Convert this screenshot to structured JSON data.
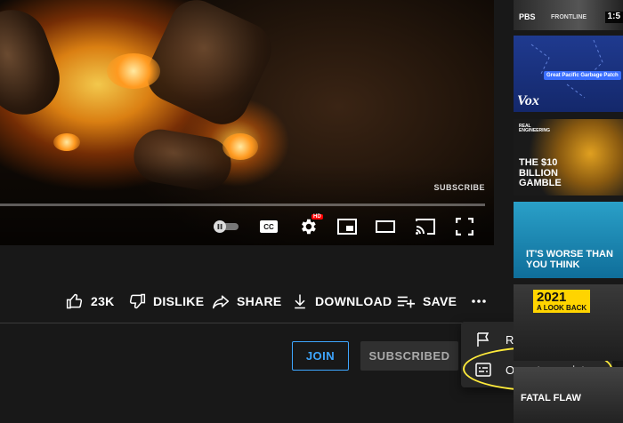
{
  "player": {
    "watermark": "SUBSCRIBE",
    "progress_fraction": 0.0,
    "controls": {
      "captions_label": "CC",
      "hd_badge": "HD"
    }
  },
  "actions": {
    "like_count": "23K",
    "dislike_label": "DISLIKE",
    "share_label": "SHARE",
    "download_label": "DOWNLOAD",
    "save_label": "SAVE"
  },
  "channel": {
    "join_label": "JOIN",
    "subscribed_label": "SUBSCRIBED"
  },
  "more_menu": {
    "items": [
      {
        "label": "Report",
        "icon": "flag-icon"
      },
      {
        "label": "Open transcript",
        "icon": "transcript-icon"
      }
    ]
  },
  "colors": {
    "accent_blue": "#3ea6ff",
    "highlight_ring": "#ffeb3b",
    "progress_red": "#ff0000",
    "background": "#181818"
  },
  "sidebar": {
    "thumbnails": [
      {
        "logo": "PBS",
        "brand": "FRONTLINE",
        "duration": "1:5"
      },
      {
        "caption": "Great Pacific Garbage Patch",
        "logo": "Vox"
      },
      {
        "brand": "REAL ENGINEERING",
        "title": "THE $10 BILLION GAMBLE"
      },
      {
        "title": "IT'S WORSE THAN YOU THINK"
      },
      {
        "title": "2021 A LOOK BACK"
      },
      {
        "title": "FATAL FLAW"
      }
    ]
  }
}
